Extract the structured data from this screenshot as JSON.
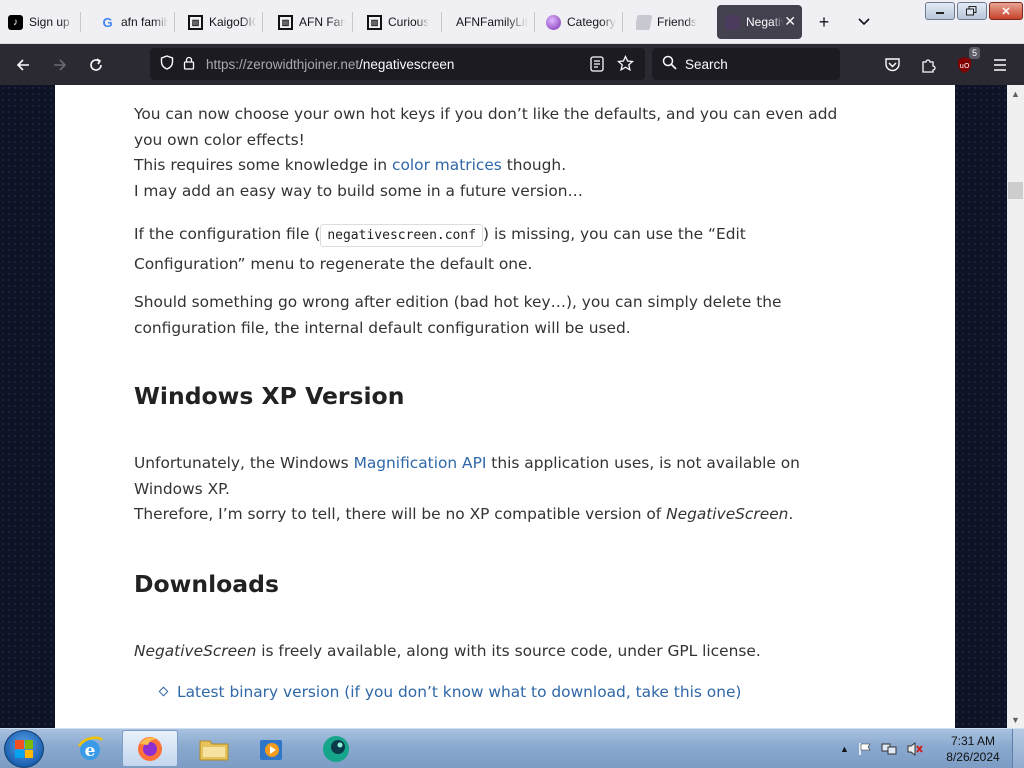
{
  "browser": {
    "tabs": [
      {
        "label": "Sign up | TikTok",
        "icon": "tiktok-icon"
      },
      {
        "label": "afn family",
        "icon": "google-icon"
      },
      {
        "label": "KaigoDIC",
        "icon": "building-icon"
      },
      {
        "label": "AFN Family",
        "icon": "building-icon"
      },
      {
        "label": "Curious",
        "icon": "building-icon"
      },
      {
        "label": "AFNFamilyLife",
        "icon": "blank-icon"
      },
      {
        "label": "Category",
        "icon": "planet-icon"
      },
      {
        "label": "Friends",
        "icon": "document-icon"
      },
      {
        "label": "NegativeScreen",
        "icon": "page-icon",
        "active": true
      }
    ],
    "new_tab_symbol": "+",
    "tab_list_symbol": "⌄",
    "url_host": "https://zerowidthjoiner.net",
    "url_path": "/negativescreen",
    "search_placeholder": "Search",
    "extension_badge": "5"
  },
  "article": {
    "p1_a": "You can now choose your own hot keys if you don’t like the defaults, and you can even add you own color effects!",
    "p1_b_pre": "This requires some knowledge in ",
    "p1_b_link": "color matrices",
    "p1_b_post": " though.",
    "p1_c": "I may add an easy way to build some in a future version…",
    "p2_pre": "If the configuration file (",
    "p2_code": "negativescreen.conf",
    "p2_post": ") is missing, you can use the “Edit Configuration” menu to regenerate the default one.",
    "p3": "Should something go wrong after edition (bad hot key…), you can simply delete the configuration file, the internal default configuration will be used.",
    "h_xp": "Windows XP Version",
    "p4_pre": "Unfortunately, the Windows ",
    "p4_link": "Magnification API",
    "p4_post": " this application uses, is not available on Windows XP.",
    "p5_pre": "Therefore, I’m sorry to tell, there will be no XP compatible version of ",
    "p5_em": "NegativeScreen",
    "p5_post": ".",
    "h_downloads": "Downloads",
    "p6_em": "NegativeScreen",
    "p6_post": " is freely available, along with its source code, under GPL license.",
    "list_item_1": "Latest binary version (if you don’t know what to download, take this one)"
  },
  "taskbar": {
    "time": "7:31 AM",
    "date": "8/26/2024"
  },
  "colors": {
    "link": "#2f67a8",
    "toolbar_dark": "#2b2a33",
    "tabstrip": "#f0f0f4"
  }
}
